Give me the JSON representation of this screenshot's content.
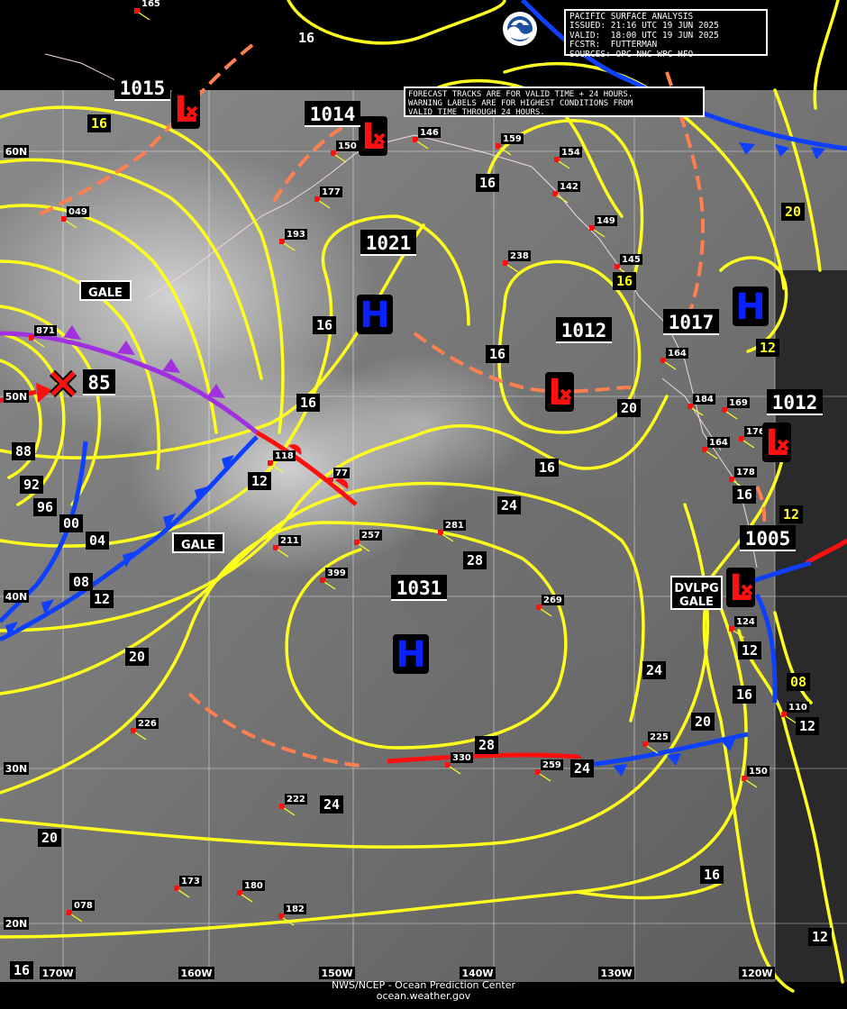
{
  "info_box": {
    "title": "PACIFIC SURFACE ANALYSIS",
    "issued": "ISSUED: 21:16 UTC 19 JUN 2025",
    "valid": "VALID:  18:00 UTC 19 JUN 2025",
    "forecaster": "FCSTR:  FUTTERMAN",
    "sources": "SOURCES: OPC NHC WPC HFO"
  },
  "note": {
    "line1": "FORECAST TRACKS ARE FOR VALID TIME + 24 HOURS.",
    "line2": "WARNING LABELS ARE FOR HIGHEST CONDITIONS FROM",
    "line3": "VALID TIME THROUGH 24 HOURS."
  },
  "logo_name": "noaa-logo",
  "footer": {
    "line1": "NWS/NCEP - Ocean Prediction Center",
    "line2": "ocean.weather.gov"
  },
  "lat_labels": [
    "60N",
    "50N",
    "40N",
    "30N",
    "20N"
  ],
  "lon_labels": [
    "170W",
    "160W",
    "150W",
    "140W",
    "130W",
    "120W"
  ],
  "pressure_centers": [
    {
      "type": "L",
      "value": "1015"
    },
    {
      "type": "L",
      "value": "1014"
    },
    {
      "type": "H",
      "value": "1021"
    },
    {
      "type": "L",
      "value": "1012"
    },
    {
      "type": "H",
      "value": "1017"
    },
    {
      "type": "L",
      "value": "1012"
    },
    {
      "type": "L",
      "value": "1005"
    },
    {
      "type": "H",
      "value": "1031"
    },
    {
      "type": "X",
      "value": "85"
    }
  ],
  "warnings": [
    "GALE",
    "GALE",
    "DVLPG",
    "GALE"
  ],
  "isobar_labels": [
    "16",
    "16",
    "16",
    "20",
    "16",
    "12",
    "16",
    "12",
    "16",
    "16",
    "20",
    "16",
    "24",
    "28",
    "28",
    "24",
    "24",
    "20",
    "12",
    "16",
    "12",
    "08",
    "16",
    "12",
    "20",
    "24",
    "20",
    "16",
    "12",
    "16",
    "88",
    "92",
    "96",
    "00",
    "04",
    "08",
    "12"
  ],
  "station_labels": [
    "165",
    "146",
    "150",
    "159",
    "154",
    "142",
    "149",
    "177",
    "193",
    "238",
    "145",
    "049",
    "164",
    "184",
    "169",
    "176",
    "164",
    "178",
    "871",
    "118",
    "281",
    "257",
    "211",
    "399",
    "269",
    "124",
    "226",
    "222",
    "330",
    "259",
    "225",
    "150",
    "173",
    "180",
    "182",
    "078",
    "110",
    "77"
  ],
  "colors": {
    "isobar": "#ffff1e",
    "cold_front": "#1040ff",
    "warm_front": "#ff1010",
    "occluded_front": "#a030e0",
    "trough": "#ff7f50",
    "low": "#ff0000",
    "high": "#0000ff"
  }
}
